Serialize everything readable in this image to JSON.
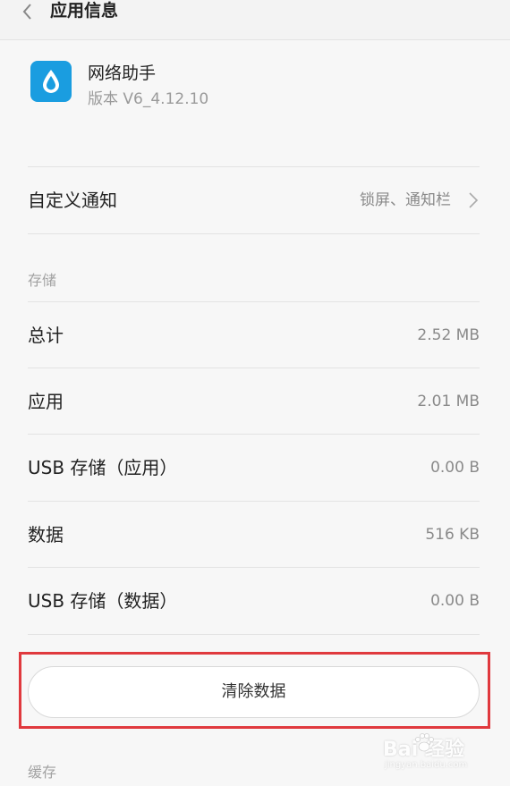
{
  "header": {
    "title": "应用信息"
  },
  "app": {
    "name": "网络助手",
    "version": "版本 V6_4.12.10"
  },
  "notification": {
    "label": "自定义通知",
    "value": "锁屏、通知栏"
  },
  "storage": {
    "section_title": "存储",
    "rows": [
      {
        "label": "总计",
        "value": "2.52 MB"
      },
      {
        "label": "应用",
        "value": "2.01 MB"
      },
      {
        "label": "USB 存储（应用）",
        "value": "0.00 B"
      },
      {
        "label": "数据",
        "value": "516 KB"
      },
      {
        "label": "USB 存储（数据）",
        "value": "0.00 B"
      }
    ],
    "clear_button_label": "清除数据"
  },
  "cache": {
    "section_title": "缓存"
  },
  "watermark": {
    "logo": "Bai 经验",
    "url": "jingyan.baidu.com"
  },
  "colors": {
    "accent": "#1a9de0",
    "highlight": "#e0393e"
  }
}
